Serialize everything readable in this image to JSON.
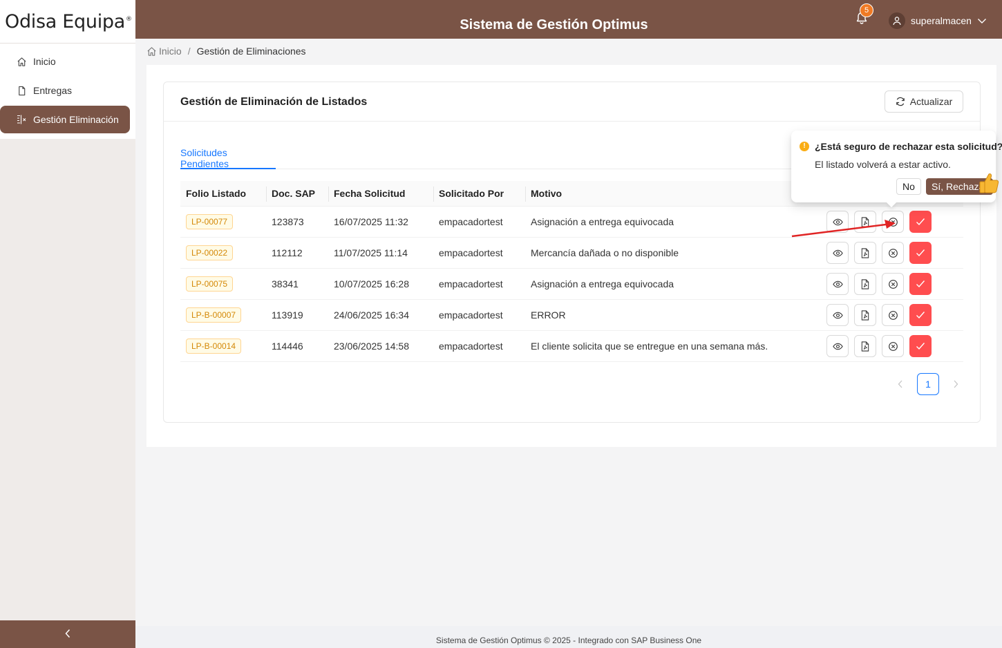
{
  "brand": {
    "logo_text": "Odisa Equipa",
    "logo_mark": "®"
  },
  "header": {
    "title": "Sistema de Gestión Optimus",
    "notification_count": "5",
    "username": "superalmacen"
  },
  "sidebar": {
    "items": [
      {
        "label": "Inicio",
        "icon": "home-icon"
      },
      {
        "label": "Entregas",
        "icon": "file-icon"
      },
      {
        "label": "Gestión Eliminación",
        "icon": "delete-column-icon",
        "active": true
      }
    ]
  },
  "breadcrumb": {
    "home": "Inicio",
    "separator": "/",
    "current": "Gestión de Eliminaciones"
  },
  "card": {
    "title": "Gestión de Eliminación de Listados",
    "refresh_label": "Actualizar",
    "tab_label": "Solicitudes Pendientes"
  },
  "table": {
    "columns": [
      "Folio Listado",
      "Doc. SAP",
      "Fecha Solicitud",
      "Solicitado Por",
      "Motivo"
    ],
    "rows": [
      {
        "folio": "LP-00077",
        "doc": "123873",
        "fecha": "16/07/2025 11:32",
        "por": "empacadortest",
        "motivo": "Asignación a entrega equivocada"
      },
      {
        "folio": "LP-00022",
        "doc": "112112",
        "fecha": "11/07/2025 11:14",
        "por": "empacadortest",
        "motivo": "Mercancía dañada o no disponible"
      },
      {
        "folio": "LP-00075",
        "doc": "38341",
        "fecha": "10/07/2025 16:28",
        "por": "empacadortest",
        "motivo": "Asignación a entrega equivocada"
      },
      {
        "folio": "LP-B-00007",
        "doc": "113919",
        "fecha": "24/06/2025 16:34",
        "por": "empacadortest",
        "motivo": "ERROR"
      },
      {
        "folio": "LP-B-00014",
        "doc": "114446",
        "fecha": "23/06/2025 14:58",
        "por": "empacadortest",
        "motivo": "El cliente solicita que se entregue en una semana más."
      }
    ]
  },
  "pagination": {
    "current_page": "1"
  },
  "popconfirm": {
    "title": "¿Está seguro de rechazar esta solicitud?",
    "description": "El listado volverá a estar activo.",
    "cancel_label": "No",
    "confirm_label": "Sí, Rechazar"
  },
  "footer": {
    "text": "Sistema de Gestión Optimus © 2025 - Integrado con SAP Business One"
  },
  "colors": {
    "brand": "#7a5446",
    "primary": "#1677ff",
    "danger": "#ff4d4f",
    "warning": "#faad14",
    "badge": "#f07a24"
  }
}
